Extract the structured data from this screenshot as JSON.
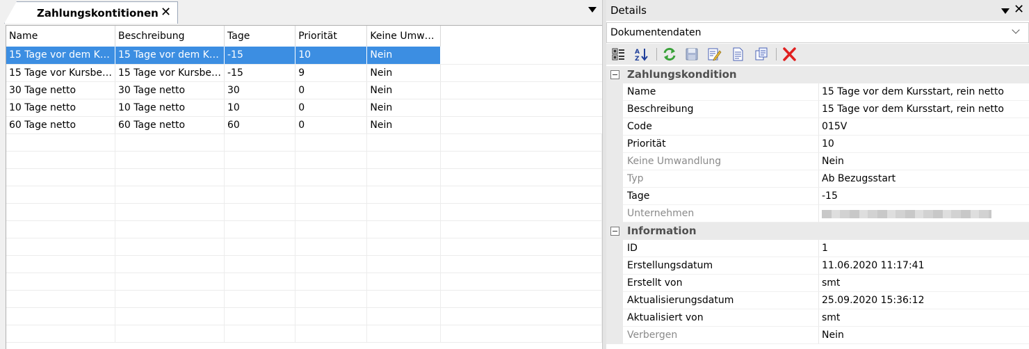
{
  "left_pane": {
    "tab_title": "Zahlungskontitionen",
    "columns": [
      "Name",
      "Beschreibung",
      "Tage",
      "Priorität",
      "Keine Umw…"
    ],
    "rows": [
      [
        "15 Tage vor dem K…",
        "15 Tage vor dem K…",
        "-15",
        "10",
        "Nein"
      ],
      [
        "15 Tage vor Kursbe…",
        "15 Tage vor Kursbe…",
        "-15",
        "9",
        "Nein"
      ],
      [
        "30 Tage netto",
        "30 Tage netto",
        "30",
        "0",
        "Nein"
      ],
      [
        "10 Tage netto",
        "10 Tage netto",
        "10",
        "0",
        "Nein"
      ],
      [
        "60 Tage netto",
        "60 Tage netto",
        "60",
        "0",
        "Nein"
      ]
    ],
    "selected_row": 0
  },
  "details": {
    "title": "Details",
    "combo_value": "Dokumentendaten",
    "toolbar_icons": [
      "categorize-icon",
      "sort-alpha-icon",
      "refresh-icon",
      "save-icon",
      "edit-icon",
      "new-document-icon",
      "copy-icon",
      "delete-icon"
    ],
    "categories": [
      {
        "label": "Zahlungskondition",
        "rows": [
          {
            "key": "Name",
            "value": "15 Tage vor dem Kursstart, rein netto",
            "dim": false
          },
          {
            "key": "Beschreibung",
            "value": "15 Tage vor dem Kursstart, rein netto",
            "dim": false
          },
          {
            "key": "Code",
            "value": "015V",
            "dim": false
          },
          {
            "key": "Priorität",
            "value": "10",
            "dim": false
          },
          {
            "key": "Keine Umwandlung",
            "value": "Nein",
            "dim": true
          },
          {
            "key": "Typ",
            "value": "Ab Bezugsstart",
            "dim": true
          },
          {
            "key": "Tage",
            "value": "-15",
            "dim": false
          },
          {
            "key": "Unternehmen",
            "value": "",
            "dim": true,
            "redacted": true
          }
        ]
      },
      {
        "label": "Information",
        "rows": [
          {
            "key": "ID",
            "value": "1",
            "dim": false
          },
          {
            "key": "Erstellungsdatum",
            "value": "11.06.2020 11:17:41",
            "dim": false
          },
          {
            "key": "Erstellt von",
            "value": "smt",
            "dim": false
          },
          {
            "key": "Aktualisierungsdatum",
            "value": "25.09.2020 15:36:12",
            "dim": false
          },
          {
            "key": "Aktualisiert von",
            "value": "smt",
            "dim": false
          },
          {
            "key": "Verbergen",
            "value": "Nein",
            "dim": true
          }
        ]
      }
    ]
  },
  "colors": {
    "selection": "#3c8ee2",
    "category_bg": "#eaeaea",
    "dim_text": "#8a8a8a"
  }
}
